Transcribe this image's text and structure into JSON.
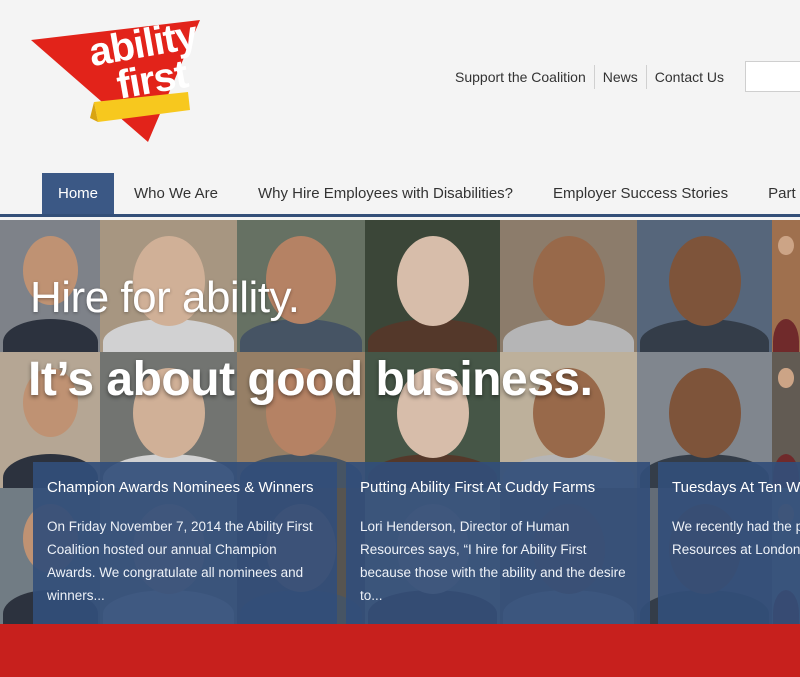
{
  "logo": {
    "line1": "ability",
    "line2": "first",
    "colors": {
      "triangle": "#e2231a",
      "ribbon": "#f7c81e"
    }
  },
  "top_links": [
    "Support the Coalition",
    "News",
    "Contact Us"
  ],
  "search": {
    "placeholder": ""
  },
  "nav": {
    "items": [
      "Home",
      "Who We Are",
      "Why Hire Employees with Disabilities?",
      "Employer Success Stories",
      "Part"
    ],
    "active_index": 0,
    "active_color": "#3b5885"
  },
  "hero": {
    "line1": "Hire for ability.",
    "line2": "It’s about good business."
  },
  "cards": [
    {
      "title": "Champion Awards Nominees & Winners",
      "body": "On Friday November 7, 2014 the Ability First Coalition hosted our annual Champion Awards. We congratulate all nominees and winners..."
    },
    {
      "title": "Putting Ability First At Cuddy Farms",
      "body": "Lori Henderson, Director of Human Resources says, “I hire for Ability First because those with the ability and the desire to..."
    },
    {
      "title": "Tuesdays At Ten Wi",
      "body": "We recently had the p with Sandy Plant, Sen Resources at London value..."
    }
  ],
  "colors": {
    "nav_border": "#334f78",
    "card_bg": "#324e7a",
    "footer_band": "#c7201d"
  }
}
